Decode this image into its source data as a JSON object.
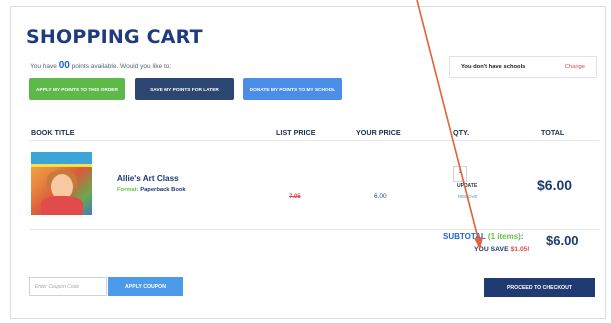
{
  "page": {
    "title": "SHOPPING CART",
    "points_prefix": "You have",
    "points_count": "00",
    "points_suffix": "points available. Would you like to:"
  },
  "buttons": {
    "apply_points": "APPLY MY POINTS TO THIS ORDER",
    "save_points": "SAVE MY POINTS FOR LATER",
    "donate_points": "DONATE MY POINTS TO MY SCHOOL"
  },
  "schools": {
    "label": "You don't have schools",
    "change": "Change"
  },
  "table": {
    "headers": {
      "book_title": "BOOK TITLE",
      "list_price": "LIST PRICE",
      "your_price": "YOUR PRICE",
      "qty": "QTY.",
      "total": "TOTAL"
    },
    "items": [
      {
        "title": "Allie's Art Class",
        "format_label": "Format:",
        "format_value": "Paperback Book",
        "list_price": "7.05",
        "your_price": "6.00",
        "qty": "1",
        "update": "UPDATE",
        "remove": "REMOVE",
        "total": "$6.00"
      }
    ]
  },
  "summary": {
    "subtotal_label": "SUBTOTAL",
    "items_text": "(1 items)",
    "subtotal_value": "$6.00",
    "you_save_label": "YOU SAVE",
    "you_save_value": "$1.05!"
  },
  "coupon": {
    "placeholder": "Enter Coupon Code",
    "apply_label": "APPLY COUPON"
  },
  "checkout": {
    "label": "PROCEED TO CHECKOUT"
  },
  "colors": {
    "title": "#1f3b80",
    "green": "#5fb94a",
    "navy": "#2b4670",
    "blue": "#4b8ee8",
    "red": "#e34b4b",
    "annotation_arrow": "#e0643a"
  }
}
